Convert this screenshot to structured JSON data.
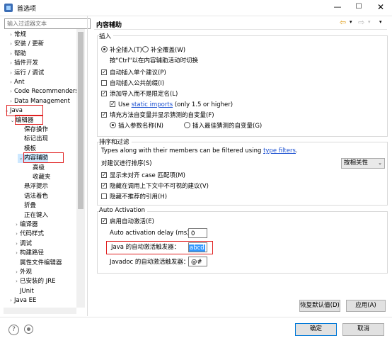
{
  "window": {
    "title": "首选项",
    "min_icon": "minimize-icon",
    "max_icon": "maximize-icon",
    "close_icon": "close-icon"
  },
  "filter": {
    "placeholder": "输入过滤器文本"
  },
  "tree": {
    "items": [
      {
        "label": "常规",
        "twisty": ">"
      },
      {
        "label": "安装 / 更新",
        "twisty": ">"
      },
      {
        "label": "帮助",
        "twisty": ">"
      },
      {
        "label": "插件开发",
        "twisty": ">"
      },
      {
        "label": "运行 / 调试",
        "twisty": ">"
      },
      {
        "label": "Ant",
        "twisty": ">"
      },
      {
        "label": "Code Recommenders",
        "twisty": ">"
      },
      {
        "label": "Data Management",
        "twisty": ">"
      },
      {
        "label": "Java",
        "twisty": "v"
      },
      {
        "label": "编辑器",
        "twisty": "v"
      },
      {
        "label": "保存操作",
        "twisty": ""
      },
      {
        "label": "标记出现",
        "twisty": ""
      },
      {
        "label": "模板",
        "twisty": ""
      },
      {
        "label": "内容辅助",
        "twisty": "v"
      },
      {
        "label": "高级",
        "twisty": ""
      },
      {
        "label": "收藏夹",
        "twisty": ""
      },
      {
        "label": "悬浮提示",
        "twisty": ""
      },
      {
        "label": "语法着色",
        "twisty": ""
      },
      {
        "label": "折叠",
        "twisty": ""
      },
      {
        "label": "正在键入",
        "twisty": ""
      },
      {
        "label": "编译器",
        "twisty": ">"
      },
      {
        "label": "代码样式",
        "twisty": ">"
      },
      {
        "label": "调试",
        "twisty": ">"
      },
      {
        "label": "构建路径",
        "twisty": ">"
      },
      {
        "label": "属性文件编辑器",
        "twisty": ""
      },
      {
        "label": "外观",
        "twisty": ">"
      },
      {
        "label": "已安装的 JRE",
        "twisty": ">"
      },
      {
        "label": "JUnit",
        "twisty": ""
      },
      {
        "label": "Java EE",
        "twisty": ">"
      }
    ]
  },
  "page": {
    "title": "内容辅助",
    "nav": {
      "back": "⇦",
      "forward": "⇨",
      "dropdown": "▾",
      "menu": "▾"
    }
  },
  "insert_group": {
    "label": "插入",
    "radio_insert": "补全插入(T)",
    "radio_overwrite": "补全覆盖(W)",
    "hint": "按\"Ctrl\"以在内容辅助活动时切换",
    "auto_single": "自动插入单个建议(P)",
    "auto_common_prefix": "自动插入公共前缀(I)",
    "add_import": "添加导入而不是限定名(L)",
    "use_static_prefix": "Use",
    "use_static_link": "static imports",
    "use_static_suffix": "(only 1.5 or higher)",
    "fill_args": "填充方法自变量并显示猜测的自变量(F)",
    "radio_param_names": "插入参数名称(N)",
    "radio_guessed_args": "插入最佳猜测的自变量(G)"
  },
  "sort_group": {
    "label": "排序和过滤",
    "types_prefix": "Types along with their members can be filtered using",
    "types_link": "type filters",
    "types_suffix": ".",
    "sort_label": "对建议进行排序(S)",
    "sort_value": "按相关性",
    "show_camel": "显示未对齐 case 匹配项(M)",
    "hide_not_visible": "隐藏在调用上下文中不可视的建议(V)",
    "hide_deprecated": "隐藏不推荐的引用(H)"
  },
  "auto_group": {
    "label": "Auto Activation",
    "enable": "启用自动激活(E)",
    "delay_label": "Auto activation delay (ms):",
    "delay_value": "0",
    "java_triggers_label": "Java 的自动激活触发器：",
    "java_triggers_value": "abcd",
    "javadoc_triggers_label": "Javadoc 的自动激活触发器：",
    "javadoc_triggers_value": "@#"
  },
  "buttons": {
    "restore_defaults": "恢复默认值(D)",
    "apply": "应用(A)",
    "ok": "确定",
    "cancel": "取消"
  },
  "bottom_icons": {
    "help": "?",
    "record": "record-icon"
  }
}
